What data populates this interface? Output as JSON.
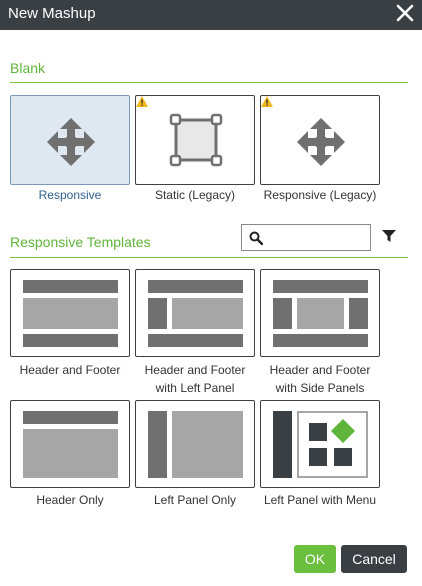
{
  "dialog": {
    "title": "New Mashup"
  },
  "blank": {
    "label": "Blank",
    "items": [
      {
        "label": "Responsive"
      },
      {
        "label": "Static (Legacy)"
      },
      {
        "label": "Responsive (Legacy)"
      }
    ]
  },
  "templates": {
    "label": "Responsive Templates",
    "search": {
      "value": "",
      "placeholder": ""
    },
    "items": [
      {
        "label_line1": "Header and Footer",
        "label_line2": ""
      },
      {
        "label_line1": "Header and Footer",
        "label_line2": "with Left Panel"
      },
      {
        "label_line1": "Header and Footer",
        "label_line2": "with Side Panels"
      },
      {
        "label_line1": "Header Only",
        "label_line2": ""
      },
      {
        "label_line1": "Left Panel Only",
        "label_line2": ""
      },
      {
        "label_line1": "Left Panel with Menu",
        "label_line2": ""
      }
    ]
  },
  "buttons": {
    "ok": "OK",
    "cancel": "Cancel"
  },
  "colors": {
    "accent": "#5fb43a",
    "titlebar": "#3a3f44",
    "selected": "#dfe8f1",
    "warning": "#f3b81c"
  }
}
